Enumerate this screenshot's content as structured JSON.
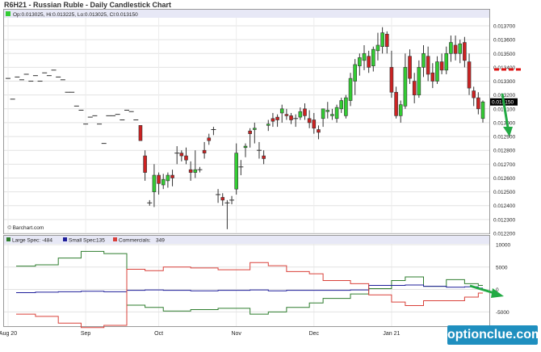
{
  "title": "R6H21 - Russian Ruble - Daily Candlestick Chart",
  "ohlc_label": "Op:0.013025, Hi:0.013225, Lo:0.013025, Cl:0.013150",
  "last_price_label": "0.013150",
  "credit": "© Barchart.com",
  "watermark": "optionclue.com",
  "colors": {
    "up": "#33cc33",
    "down": "#cc2222",
    "large_spec": "#2e7d2e",
    "small_spec": "#1f1f9a",
    "commercials": "#d9413a",
    "arrow": "#22aa44",
    "dash": "#dd1111",
    "header_bg": "#e7e8f6"
  },
  "chart_data": [
    {
      "type": "candlestick",
      "title": "R6H21 - Russian Ruble - Daily Candlestick Chart",
      "yticks": [
        "0.013700",
        "0.013600",
        "0.013500",
        "0.013400",
        "0.013300",
        "0.013200",
        "0.013100",
        "0.013000",
        "0.012900",
        "0.012800",
        "0.012700",
        "0.012600",
        "0.012500",
        "0.012400",
        "0.012300",
        "0.012200"
      ],
      "ylim": [
        0.0122,
        0.0137
      ],
      "xticks": [
        "Aug 20",
        "Sep",
        "Oct",
        "Nov",
        "Dec",
        "Jan 21"
      ],
      "grid": true,
      "last_price": 0.01315,
      "candles": [
        {
          "d": 0,
          "o": 0.01332,
          "h": 0.01332,
          "l": 0.01332,
          "c": 0.01332
        },
        {
          "d": 1,
          "o": 0.01317,
          "h": 0.01317,
          "l": 0.01317,
          "c": 0.01317
        },
        {
          "d": 2,
          "o": 0.01333,
          "h": 0.01333,
          "l": 0.01333,
          "c": 0.01333
        },
        {
          "d": 3,
          "o": 0.01331,
          "h": 0.01331,
          "l": 0.01331,
          "c": 0.01331
        },
        {
          "d": 4,
          "o": 0.01335,
          "h": 0.01335,
          "l": 0.01335,
          "c": 0.01335
        },
        {
          "d": 5,
          "o": 0.0133,
          "h": 0.0133,
          "l": 0.0133,
          "c": 0.0133
        },
        {
          "d": 6,
          "o": 0.01334,
          "h": 0.01334,
          "l": 0.01334,
          "c": 0.01334
        },
        {
          "d": 7,
          "o": 0.0133,
          "h": 0.0133,
          "l": 0.0133,
          "c": 0.0133
        },
        {
          "d": 8,
          "o": 0.01336,
          "h": 0.01336,
          "l": 0.01336,
          "c": 0.01336
        },
        {
          "d": 9,
          "o": 0.01334,
          "h": 0.01334,
          "l": 0.01334,
          "c": 0.01334
        },
        {
          "d": 10,
          "o": 0.01338,
          "h": 0.01338,
          "l": 0.01338,
          "c": 0.01338
        },
        {
          "d": 11,
          "o": 0.01333,
          "h": 0.01333,
          "l": 0.01333,
          "c": 0.01333
        },
        {
          "d": 12,
          "o": 0.01331,
          "h": 0.01331,
          "l": 0.01331,
          "c": 0.01331
        },
        {
          "d": 13,
          "o": 0.01322,
          "h": 0.01322,
          "l": 0.01322,
          "c": 0.01322
        },
        {
          "d": 14,
          "o": 0.01322,
          "h": 0.01322,
          "l": 0.01322,
          "c": 0.01322
        },
        {
          "d": 15,
          "o": 0.01312,
          "h": 0.01312,
          "l": 0.01312,
          "c": 0.01312
        },
        {
          "d": 16,
          "o": 0.01309,
          "h": 0.01309,
          "l": 0.01309,
          "c": 0.01309
        },
        {
          "d": 17,
          "o": 0.01299,
          "h": 0.01299,
          "l": 0.01299,
          "c": 0.01299
        },
        {
          "d": 18,
          "o": 0.01304,
          "h": 0.01304,
          "l": 0.01304,
          "c": 0.01304
        },
        {
          "d": 19,
          "o": 0.01305,
          "h": 0.01305,
          "l": 0.01305,
          "c": 0.01305
        },
        {
          "d": 20,
          "o": 0.01299,
          "h": 0.01299,
          "l": 0.01299,
          "c": 0.01299
        },
        {
          "d": 21,
          "o": 0.01285,
          "h": 0.01285,
          "l": 0.01285,
          "c": 0.01285
        },
        {
          "d": 22,
          "o": 0.01305,
          "h": 0.01305,
          "l": 0.01305,
          "c": 0.01305
        },
        {
          "d": 23,
          "o": 0.01305,
          "h": 0.01305,
          "l": 0.01305,
          "c": 0.01305
        },
        {
          "d": 24,
          "o": 0.01306,
          "h": 0.01306,
          "l": 0.01306,
          "c": 0.01306
        },
        {
          "d": 25,
          "o": 0.01302,
          "h": 0.01302,
          "l": 0.01302,
          "c": 0.01302
        },
        {
          "d": 26,
          "o": 0.01309,
          "h": 0.01309,
          "l": 0.01309,
          "c": 0.01309
        },
        {
          "d": 27,
          "o": 0.01308,
          "h": 0.01308,
          "l": 0.01308,
          "c": 0.01308
        },
        {
          "d": 28,
          "o": 0.01302,
          "h": 0.01302,
          "l": 0.01302,
          "c": 0.01302
        },
        {
          "d": 29,
          "o": 0.01298,
          "h": 0.01298,
          "l": 0.01287,
          "c": 0.01287
        },
        {
          "d": 30,
          "o": 0.01276,
          "h": 0.0128,
          "l": 0.01258,
          "c": 0.01264
        },
        {
          "d": 31,
          "o": 0.01242,
          "h": 0.01244,
          "l": 0.0124,
          "c": 0.01242
        },
        {
          "d": 32,
          "o": 0.0125,
          "h": 0.0127,
          "l": 0.01239,
          "c": 0.01262
        },
        {
          "d": 33,
          "o": 0.01262,
          "h": 0.01264,
          "l": 0.01248,
          "c": 0.01256
        },
        {
          "d": 34,
          "o": 0.01255,
          "h": 0.01263,
          "l": 0.01252,
          "c": 0.01259
        },
        {
          "d": 35,
          "o": 0.01258,
          "h": 0.01264,
          "l": 0.01253,
          "c": 0.01262
        },
        {
          "d": 36,
          "o": 0.01262,
          "h": 0.01266,
          "l": 0.01254,
          "c": 0.0126
        },
        {
          "d": 37,
          "o": 0.01278,
          "h": 0.01283,
          "l": 0.0127,
          "c": 0.01278
        },
        {
          "d": 38,
          "o": 0.01278,
          "h": 0.0128,
          "l": 0.01272,
          "c": 0.01276
        },
        {
          "d": 39,
          "o": 0.01276,
          "h": 0.01282,
          "l": 0.0127,
          "c": 0.01273
        },
        {
          "d": 40,
          "o": 0.01266,
          "h": 0.01272,
          "l": 0.01258,
          "c": 0.01264
        },
        {
          "d": 41,
          "o": 0.01264,
          "h": 0.0128,
          "l": 0.0126,
          "c": 0.01266
        },
        {
          "d": 42,
          "o": 0.01266,
          "h": 0.01268,
          "l": 0.01264,
          "c": 0.01266
        },
        {
          "d": 43,
          "o": 0.0128,
          "h": 0.01286,
          "l": 0.01274,
          "c": 0.01278
        },
        {
          "d": 44,
          "o": 0.01289,
          "h": 0.01292,
          "l": 0.01284,
          "c": 0.01287
        },
        {
          "d": 45,
          "o": 0.01295,
          "h": 0.01297,
          "l": 0.01291,
          "c": 0.01295
        },
        {
          "d": 46,
          "o": 0.01248,
          "h": 0.01252,
          "l": 0.01242,
          "c": 0.01248
        },
        {
          "d": 47,
          "o": 0.01246,
          "h": 0.01249,
          "l": 0.0124,
          "c": 0.01244
        },
        {
          "d": 48,
          "o": 0.01242,
          "h": 0.01244,
          "l": 0.01223,
          "c": 0.01242
        },
        {
          "d": 49,
          "o": 0.01244,
          "h": 0.01247,
          "l": 0.01241,
          "c": 0.01244
        },
        {
          "d": 50,
          "o": 0.01252,
          "h": 0.01285,
          "l": 0.01248,
          "c": 0.01278
        },
        {
          "d": 51,
          "o": 0.01268,
          "h": 0.01273,
          "l": 0.01262,
          "c": 0.01268
        },
        {
          "d": 52,
          "o": 0.01282,
          "h": 0.01285,
          "l": 0.01275,
          "c": 0.01283
        },
        {
          "d": 53,
          "o": 0.01294,
          "h": 0.01296,
          "l": 0.01282,
          "c": 0.01292
        },
        {
          "d": 54,
          "o": 0.01295,
          "h": 0.013,
          "l": 0.01285,
          "c": 0.01296
        },
        {
          "d": 55,
          "o": 0.0128,
          "h": 0.01286,
          "l": 0.01274,
          "c": 0.0128
        },
        {
          "d": 56,
          "o": 0.01276,
          "h": 0.0128,
          "l": 0.0127,
          "c": 0.01274
        },
        {
          "d": 57,
          "o": 0.01298,
          "h": 0.01302,
          "l": 0.01294,
          "c": 0.01299
        },
        {
          "d": 58,
          "o": 0.01303,
          "h": 0.01307,
          "l": 0.01297,
          "c": 0.01301
        },
        {
          "d": 59,
          "o": 0.01304,
          "h": 0.01306,
          "l": 0.01297,
          "c": 0.01302
        },
        {
          "d": 60,
          "o": 0.01307,
          "h": 0.01313,
          "l": 0.013,
          "c": 0.0131
        },
        {
          "d": 61,
          "o": 0.01306,
          "h": 0.0131,
          "l": 0.01302,
          "c": 0.01305
        },
        {
          "d": 62,
          "o": 0.01305,
          "h": 0.01307,
          "l": 0.01299,
          "c": 0.01302
        },
        {
          "d": 63,
          "o": 0.01303,
          "h": 0.01306,
          "l": 0.01297,
          "c": 0.01303
        },
        {
          "d": 64,
          "o": 0.01304,
          "h": 0.01311,
          "l": 0.01302,
          "c": 0.01308
        },
        {
          "d": 65,
          "o": 0.0131,
          "h": 0.01314,
          "l": 0.01302,
          "c": 0.01305
        },
        {
          "d": 66,
          "o": 0.01303,
          "h": 0.01309,
          "l": 0.01296,
          "c": 0.013
        },
        {
          "d": 67,
          "o": 0.01302,
          "h": 0.01307,
          "l": 0.01292,
          "c": 0.01296
        },
        {
          "d": 68,
          "o": 0.01295,
          "h": 0.01298,
          "l": 0.01288,
          "c": 0.01293
        },
        {
          "d": 69,
          "o": 0.01303,
          "h": 0.0131,
          "l": 0.01297,
          "c": 0.0131
        },
        {
          "d": 70,
          "o": 0.01308,
          "h": 0.01315,
          "l": 0.01303,
          "c": 0.01309
        },
        {
          "d": 71,
          "o": 0.01305,
          "h": 0.0131,
          "l": 0.01302,
          "c": 0.01306
        },
        {
          "d": 72,
          "o": 0.01303,
          "h": 0.01313,
          "l": 0.013,
          "c": 0.01311
        },
        {
          "d": 73,
          "o": 0.0131,
          "h": 0.01318,
          "l": 0.01307,
          "c": 0.01316
        },
        {
          "d": 74,
          "o": 0.01305,
          "h": 0.0132,
          "l": 0.01303,
          "c": 0.01318
        },
        {
          "d": 75,
          "o": 0.01316,
          "h": 0.01336,
          "l": 0.01312,
          "c": 0.01332
        },
        {
          "d": 76,
          "o": 0.0133,
          "h": 0.01346,
          "l": 0.0132,
          "c": 0.01342
        },
        {
          "d": 77,
          "o": 0.01341,
          "h": 0.0135,
          "l": 0.01334,
          "c": 0.01347
        },
        {
          "d": 78,
          "o": 0.01345,
          "h": 0.01356,
          "l": 0.01338,
          "c": 0.0135
        },
        {
          "d": 79,
          "o": 0.01348,
          "h": 0.01352,
          "l": 0.01336,
          "c": 0.0134
        },
        {
          "d": 80,
          "o": 0.01341,
          "h": 0.01355,
          "l": 0.01337,
          "c": 0.01353
        },
        {
          "d": 81,
          "o": 0.01352,
          "h": 0.01365,
          "l": 0.01345,
          "c": 0.01356
        },
        {
          "d": 82,
          "o": 0.01355,
          "h": 0.01369,
          "l": 0.0135,
          "c": 0.01365
        },
        {
          "d": 83,
          "o": 0.01364,
          "h": 0.01366,
          "l": 0.0135,
          "c": 0.01355
        },
        {
          "d": 84,
          "o": 0.0134,
          "h": 0.01352,
          "l": 0.01318,
          "c": 0.01322
        },
        {
          "d": 85,
          "o": 0.01322,
          "h": 0.01326,
          "l": 0.01303,
          "c": 0.01305
        },
        {
          "d": 86,
          "o": 0.01305,
          "h": 0.01316,
          "l": 0.013,
          "c": 0.01313
        },
        {
          "d": 87,
          "o": 0.01312,
          "h": 0.0135,
          "l": 0.0131,
          "c": 0.0134
        },
        {
          "d": 88,
          "o": 0.01348,
          "h": 0.01353,
          "l": 0.01328,
          "c": 0.01332
        },
        {
          "d": 89,
          "o": 0.0133,
          "h": 0.01336,
          "l": 0.01314,
          "c": 0.0132
        },
        {
          "d": 90,
          "o": 0.0132,
          "h": 0.01345,
          "l": 0.01318,
          "c": 0.0134
        },
        {
          "d": 91,
          "o": 0.0134,
          "h": 0.01356,
          "l": 0.01333,
          "c": 0.0135
        },
        {
          "d": 92,
          "o": 0.01348,
          "h": 0.01355,
          "l": 0.0133,
          "c": 0.01335
        },
        {
          "d": 93,
          "o": 0.01336,
          "h": 0.01343,
          "l": 0.01325,
          "c": 0.0133
        },
        {
          "d": 94,
          "o": 0.0133,
          "h": 0.01348,
          "l": 0.01328,
          "c": 0.01344
        },
        {
          "d": 95,
          "o": 0.01344,
          "h": 0.0135,
          "l": 0.01335,
          "c": 0.01338
        },
        {
          "d": 96,
          "o": 0.01338,
          "h": 0.01355,
          "l": 0.01335,
          "c": 0.0135
        },
        {
          "d": 97,
          "o": 0.0135,
          "h": 0.01363,
          "l": 0.01344,
          "c": 0.01358
        },
        {
          "d": 98,
          "o": 0.01356,
          "h": 0.01363,
          "l": 0.01345,
          "c": 0.0135
        },
        {
          "d": 99,
          "o": 0.0135,
          "h": 0.0136,
          "l": 0.01343,
          "c": 0.01357
        },
        {
          "d": 100,
          "o": 0.01358,
          "h": 0.01362,
          "l": 0.0134,
          "c": 0.01345
        },
        {
          "d": 101,
          "o": 0.01344,
          "h": 0.0135,
          "l": 0.0132,
          "c": 0.01325
        },
        {
          "d": 102,
          "o": 0.01323,
          "h": 0.01326,
          "l": 0.01312,
          "c": 0.01318
        },
        {
          "d": 103,
          "o": 0.01318,
          "h": 0.01322,
          "l": 0.01306,
          "c": 0.0131
        },
        {
          "d": 104,
          "o": 0.01303,
          "h": 0.01316,
          "l": 0.013,
          "c": 0.01315
        }
      ]
    },
    {
      "type": "line",
      "title": "",
      "yticks": [
        "10000",
        "5000",
        "0",
        "-5000"
      ],
      "ylim": [
        -8000,
        10000
      ],
      "legend": [
        {
          "name": "Large Spec:",
          "value": "-484"
        },
        {
          "name": "Small Spec:",
          "value": "135"
        },
        {
          "name": "Commercials:",
          "value": "349"
        }
      ],
      "series": [
        {
          "name": "Large Spec",
          "x": [
            0,
            6,
            11,
            16,
            21,
            26,
            30,
            34,
            40,
            46,
            53,
            57,
            61,
            66,
            69,
            75,
            79,
            84,
            87,
            91,
            96,
            100,
            103,
            104
          ],
          "values": [
            5200,
            5500,
            7000,
            8500,
            8000,
            -3500,
            -4000,
            -4800,
            -4500,
            -4200,
            -5500,
            -5000,
            -4000,
            -3000,
            -2000,
            -1000,
            200,
            2000,
            2800,
            700,
            2200,
            1300,
            900,
            900
          ]
        },
        {
          "name": "Small Spec",
          "x": [
            0,
            6,
            11,
            16,
            21,
            26,
            30,
            34,
            40,
            46,
            53,
            57,
            61,
            66,
            69,
            75,
            79,
            84,
            87,
            91,
            96,
            100,
            103,
            104
          ],
          "values": [
            -700,
            -600,
            -500,
            -400,
            -500,
            -200,
            -100,
            -200,
            -300,
            -200,
            -100,
            -300,
            -200,
            -200,
            -200,
            -100,
            900,
            900,
            1000,
            700,
            500,
            600,
            300,
            300
          ]
        },
        {
          "name": "Commercials",
          "x": [
            0,
            6,
            11,
            16,
            21,
            26,
            30,
            34,
            40,
            46,
            53,
            57,
            61,
            66,
            69,
            75,
            79,
            84,
            87,
            91,
            96,
            100,
            103,
            104
          ],
          "values": [
            -5500,
            -6000,
            -7500,
            -8500,
            -8000,
            4500,
            4200,
            5000,
            4800,
            4400,
            6000,
            5300,
            4000,
            3500,
            2000,
            1300,
            -1200,
            -2800,
            -3600,
            -2500,
            -2500,
            -1700,
            -800,
            -800
          ]
        }
      ]
    }
  ]
}
